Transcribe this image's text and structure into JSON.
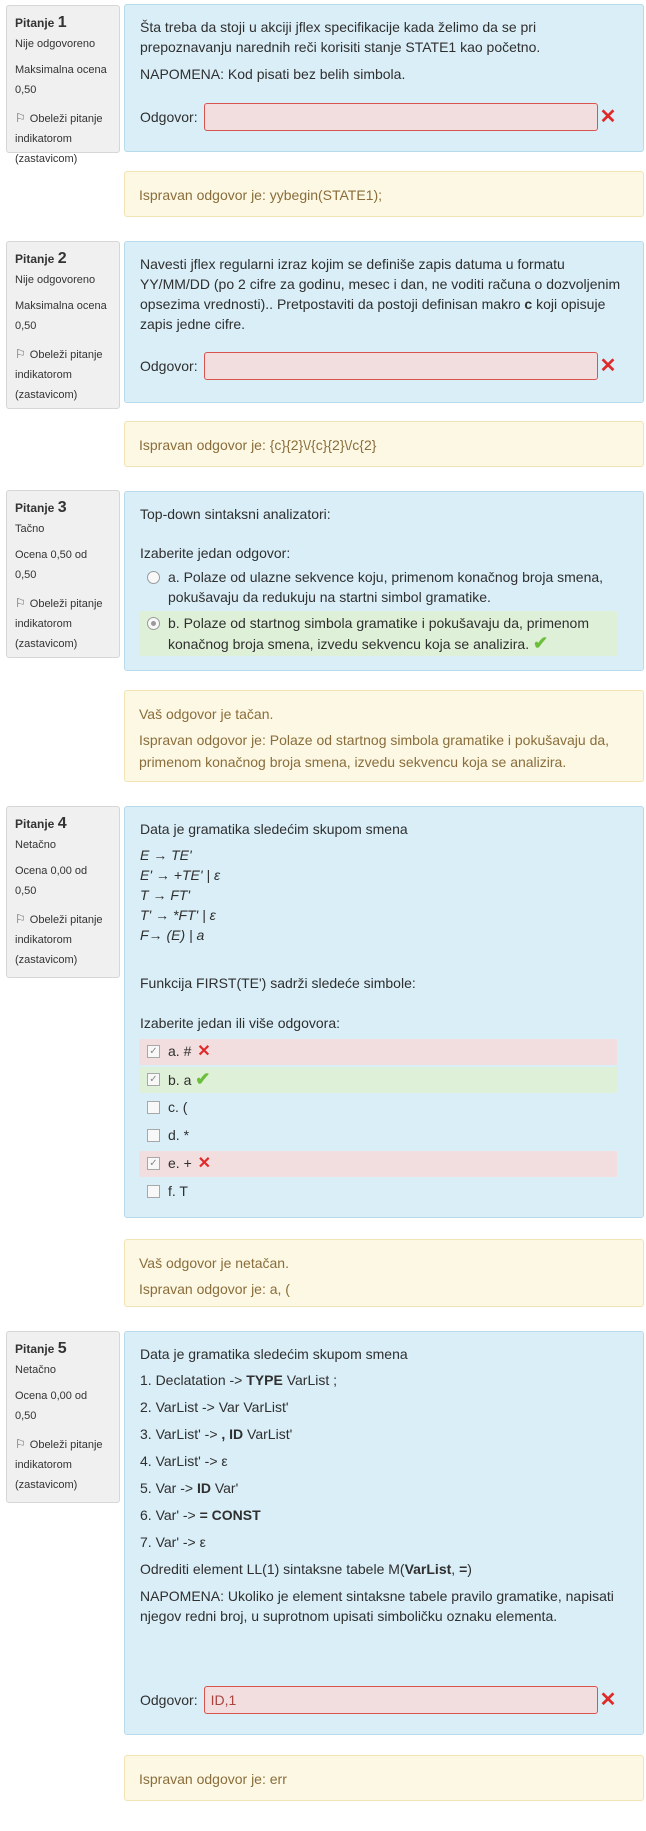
{
  "questions": [
    {
      "label": "Pitanje",
      "number": "1",
      "state": "Nije odgovoreno",
      "grade": "Maksimalna ocena 0,50",
      "flag": "Obeleži pitanje indikatorom (zastavicom)",
      "text": "Šta treba da stoji u akciji jflex specifikacije kada želimo da se pri prepoznavanju narednih reči korisiti stanje STATE1 kao početno.",
      "note": "NAPOMENA: Kod pisati bez belih simbola.",
      "answer_label": "Odgovor:",
      "answer_value": "",
      "feedback": "Ispravan odgovor je: yybegin(STATE1);"
    },
    {
      "label": "Pitanje",
      "number": "2",
      "state": "Nije odgovoreno",
      "grade": "Maksimalna ocena 0,50",
      "flag": "Obeleži pitanje indikatorom (zastavicom)",
      "text": "Navesti jflex regularni izraz kojim se definiše zapis datuma u formatu YY/MM/DD (po 2 cifre za godinu, mesec i dan, ne voditi računa o dozvoljenim opsezima vrednosti).. Pretpostaviti da postoji definisan makro c koji opisuje zapis jedne cifre.",
      "text_a": "Navesti jflex regularni izraz kojim se definiše zapis datuma u formatu YY/MM/DD (po 2 cifre za godinu, mesec i dan, ne voditi računa o dozvoljenim opsezima vrednosti).. Pretpostaviti da postoji definisan makro ",
      "text_bold": "c",
      "text_b": " koji opisuje zapis jedne cifre.",
      "answer_label": "Odgovor:",
      "answer_value": "",
      "feedback": "Ispravan odgovor je: {c}{2}\\/{c}{2}\\/c{2}"
    },
    {
      "label": "Pitanje",
      "number": "3",
      "state": "Tačno",
      "grade": "Ocena 0,50 od 0,50",
      "flag": "Obeleži pitanje indikatorom (zastavicom)",
      "text": "Top-down sintaksni analizatori:",
      "prompt": "Izaberite jedan odgovor:",
      "options": [
        {
          "text": "a. Polaze od ulazne sekvence koju, primenom konačnog broja smena, pokušavaju da redukuju na startni simbol gramatike.",
          "selected": false,
          "status": "none"
        },
        {
          "text": "b. Polaze od startnog simbola gramatike i pokušavaju da, primenom konačnog broja smena, izvedu sekvencu koja se analizira.",
          "selected": true,
          "status": "correct"
        }
      ],
      "feedback_result": "Vaš odgovor je tačan.",
      "feedback": "Ispravan odgovor je: Polaze od startnog simbola gramatike i pokušavaju da, primenom konačnog broja smena, izvedu sekvencu koja se analizira."
    },
    {
      "label": "Pitanje",
      "number": "4",
      "state": "Netačno",
      "grade": "Ocena 0,00 od 0,50",
      "flag": "Obeleži pitanje indikatorom (zastavicom)",
      "text": "Data je gramatika sledećim skupom smena",
      "rules": [
        "E → TE'",
        "E' → +TE' | ε",
        "T → FT'",
        "T' → *FT' | ε",
        "F→ (E) | a"
      ],
      "question": "Funkcija FIRST(TE') sadrži sledeće simbole:",
      "prompt": "Izaberite jedan ili više odgovora:",
      "options": [
        {
          "text": "a. #",
          "checked": true,
          "status": "wrong"
        },
        {
          "text": "b. a",
          "checked": true,
          "status": "correct"
        },
        {
          "text": "c. (",
          "checked": false,
          "status": "none"
        },
        {
          "text": "d. *",
          "checked": false,
          "status": "none"
        },
        {
          "text": "e. +",
          "checked": true,
          "status": "wrong"
        },
        {
          "text": "f. T",
          "checked": false,
          "status": "none"
        }
      ],
      "feedback_result": "Vaš odgovor je netačan.",
      "feedback": "Ispravan odgovor je: a, ("
    },
    {
      "label": "Pitanje",
      "number": "5",
      "state": "Netačno",
      "grade": "Ocena 0,00 od 0,50",
      "flag": "Obeleži pitanje indikatorom (zastavicom)",
      "text": "Data je gramatika sledećim skupom smena",
      "lines": [
        {
          "pre": "1. Declatation -> ",
          "bold": "TYPE",
          "post": " VarList ;"
        },
        {
          "pre": "2. VarList -> Var VarList'",
          "bold": "",
          "post": ""
        },
        {
          "pre": "3.  VarList' -> ",
          "bold": ", ID",
          "post": " VarList'"
        },
        {
          "pre": "4. VarList' -> ε",
          "bold": "",
          "post": ""
        },
        {
          "pre": "5. Var -> ",
          "bold": "ID",
          "post": " Var'"
        },
        {
          "pre": "6. Var' -> ",
          "bold": "= CONST",
          "post": ""
        },
        {
          "pre": "7.  Var' -> ε",
          "bold": "",
          "post": ""
        }
      ],
      "task_pre": "Odrediti element LL(1) sintaksne tabele M(",
      "task_bold1": "VarList",
      "task_mid": ", ",
      "task_bold2": "=",
      "task_post": ")",
      "note": "NAPOMENA: Ukoliko je element sintaksne tabele pravilo gramatike, napisati njegov redni broj, u suprotnom upisati simboličku oznaku elementa.",
      "answer_label": "Odgovor:",
      "answer_value": "ID,1",
      "feedback": "Ispravan odgovor je: err"
    }
  ],
  "icons": {
    "flag": "flag-icon",
    "wrong": "cross-icon",
    "right": "check-icon"
  },
  "colors": {
    "content_bg": "#d9eef7",
    "feedback_bg": "#fcf8e3",
    "wrong_bg": "#f2dede",
    "correct_bg": "#dff0d8",
    "wrong_mark": "#e02a2a",
    "right_mark": "#6bbf3b"
  }
}
